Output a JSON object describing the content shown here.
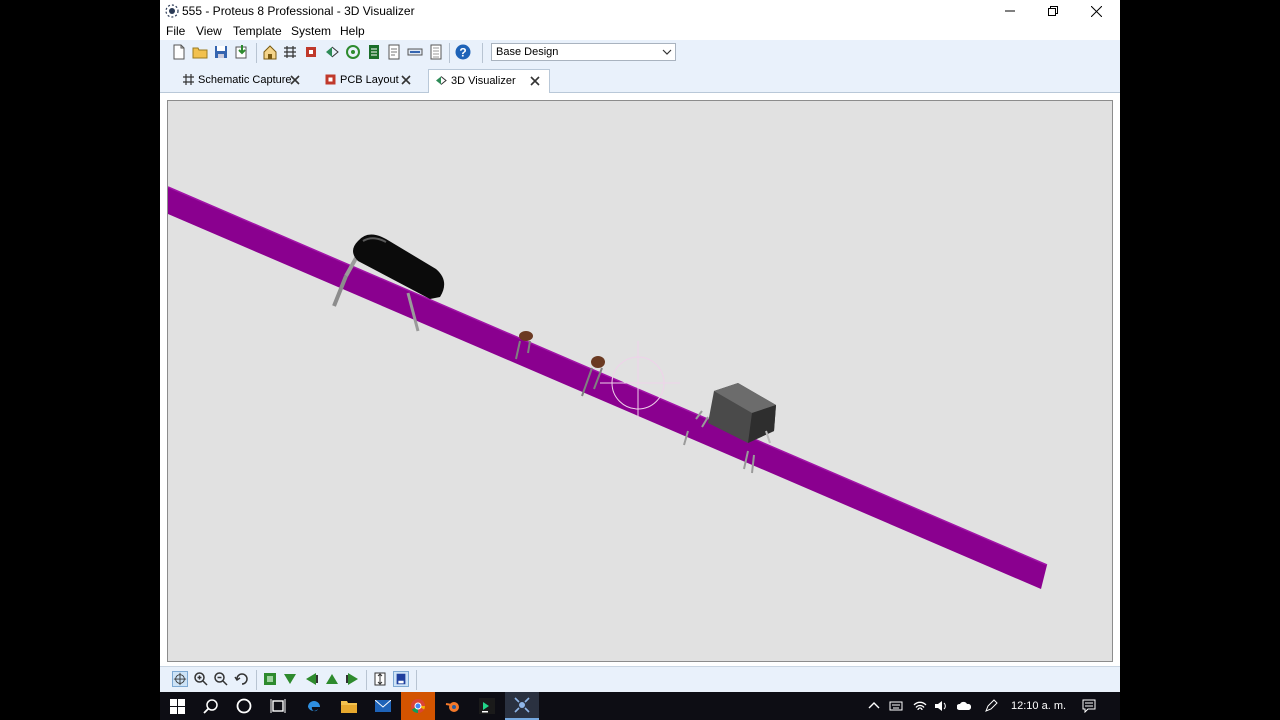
{
  "window": {
    "title": "555 - Proteus 8 Professional - 3D Visualizer",
    "icon": "proteus-app-icon",
    "controls": [
      "minimize-icon",
      "restore-icon",
      "close-icon"
    ]
  },
  "menu": {
    "items": [
      {
        "label": "File"
      },
      {
        "label": "View"
      },
      {
        "label": "Template"
      },
      {
        "label": "System"
      },
      {
        "label": "Help"
      }
    ]
  },
  "toolbar": {
    "icons": [
      "new-file-icon",
      "open-folder-icon",
      "save-icon",
      "import-icon",
      "home-icon",
      "schematic-icon",
      "pcb-icon",
      "3d-icon",
      "gerber-icon",
      "bom-icon",
      "design-notes-icon",
      "netlist-icon",
      "report-icon",
      "help-icon"
    ],
    "variant_select": {
      "value": "Base Design"
    }
  },
  "tabs": [
    {
      "label": "Schematic Capture",
      "icon": "schematic-icon",
      "active": false
    },
    {
      "label": "PCB Layout",
      "icon": "pcb-icon",
      "active": false
    },
    {
      "label": "3D Visualizer",
      "icon": "3d-icon",
      "active": true
    }
  ],
  "viewport": {
    "board_color": "#8a008f",
    "background_color": "#e1e1e1",
    "components": [
      "electrolytic-capacitor",
      "ceramic-capacitor",
      "ceramic-capacitor",
      "ic-package"
    ]
  },
  "bottom_toolbar": {
    "icons": [
      "pan-icon",
      "zoom-in-icon",
      "zoom-out-icon",
      "undo-view-icon",
      "top-view-icon",
      "bottom-view-icon",
      "left-view-icon",
      "front-view-icon",
      "right-view-icon",
      "fit-height-icon",
      "layer-toggle-icon"
    ]
  },
  "taskbar": {
    "icons": [
      "windows-start-icon",
      "search-icon",
      "cortana-icon",
      "task-view-icon",
      "edge-icon",
      "file-explorer-icon",
      "mail-icon",
      "chrome-icon",
      "blender-icon",
      "pycharm-icon",
      "proteus-icon"
    ],
    "tray_icons": [
      "chevron-up-icon",
      "keyboard-icon",
      "wifi-icon",
      "volume-icon",
      "onedrive-icon",
      "pen-icon"
    ],
    "clock": "12:10 a. m.",
    "notification_icon": "action-center-icon"
  },
  "colors": {
    "accent": "#1e7ad2",
    "toolbar_bg": "#e9f1fb",
    "taskbar_bg": "#0d0d14"
  }
}
